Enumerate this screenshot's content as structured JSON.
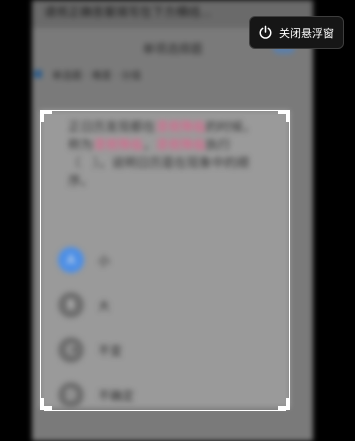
{
  "floating_button": {
    "label": "关闭悬浮窗",
    "icon": "power-icon"
  },
  "background": {
    "top_text": "请将正确答案填写在下方横线...",
    "tab_title": "单项选择题",
    "meta": "单选题 · 难度 · 分值"
  },
  "question": {
    "part1": "正日历发现都在",
    "hl1": "漆夜降临",
    "part2": "的时候，称为",
    "hl2": "漆夜降临",
    "part3": "，",
    "hl3": "漆夜降临",
    "part4": "执行（　）。",
    "part5": "说明日历是在现象中的顺序。"
  },
  "options": [
    {
      "icon": "option-a-icon",
      "letter": "A",
      "text": "小",
      "selected": true
    },
    {
      "icon": "option-b-icon",
      "letter": "B",
      "text": "大",
      "selected": false
    },
    {
      "icon": "option-c-icon",
      "letter": "C",
      "text": "不变",
      "selected": false
    },
    {
      "icon": "option-d-icon",
      "letter": "D",
      "text": "不确定",
      "selected": false
    }
  ],
  "colors": {
    "accent": "#4d8fe6",
    "highlight": "#ec5a8a"
  }
}
